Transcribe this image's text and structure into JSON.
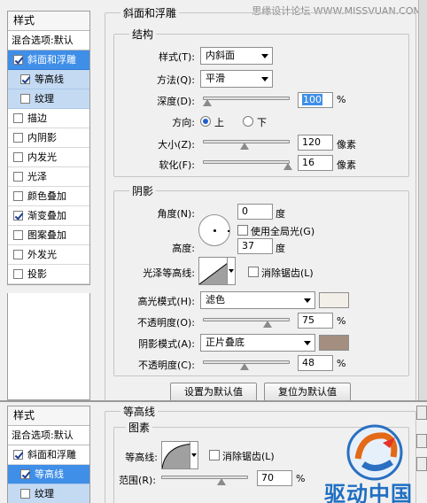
{
  "watermark": "思缘设计论坛 WWW.MISSVUAN.COM",
  "sidebar": {
    "header": "样式",
    "blend_options": "混合选项:默认",
    "items": [
      {
        "label": "斜面和浮雕",
        "checked": true,
        "selected": true,
        "sub": false
      },
      {
        "label": "等高线",
        "checked": true,
        "selected": false,
        "sub": true
      },
      {
        "label": "纹理",
        "checked": false,
        "selected": false,
        "sub": true
      },
      {
        "label": "描边",
        "checked": false,
        "selected": false,
        "sub": false
      },
      {
        "label": "内阴影",
        "checked": false,
        "selected": false,
        "sub": false
      },
      {
        "label": "内发光",
        "checked": false,
        "selected": false,
        "sub": false
      },
      {
        "label": "光泽",
        "checked": false,
        "selected": false,
        "sub": false
      },
      {
        "label": "颜色叠加",
        "checked": false,
        "selected": false,
        "sub": false
      },
      {
        "label": "渐变叠加",
        "checked": true,
        "selected": false,
        "sub": false
      },
      {
        "label": "图案叠加",
        "checked": false,
        "selected": false,
        "sub": false
      },
      {
        "label": "外发光",
        "checked": false,
        "selected": false,
        "sub": false
      },
      {
        "label": "投影",
        "checked": false,
        "selected": false,
        "sub": false
      }
    ]
  },
  "bevel": {
    "title": "斜面和浮雕",
    "structure": {
      "title": "结构",
      "style_label": "样式(T):",
      "style_value": "内斜面",
      "method_label": "方法(Q):",
      "method_value": "平滑",
      "depth_label": "深度(D):",
      "depth_value": "100",
      "depth_unit": "%",
      "depth_slider": 0.03,
      "direction_label": "方向:",
      "dir_up": "上",
      "dir_down": "下",
      "size_label": "大小(Z):",
      "size_value": "120",
      "size_unit": "像素",
      "size_slider": 0.48,
      "soften_label": "软化(F):",
      "soften_value": "16",
      "soften_unit": "像素",
      "soften_slider": 1.0
    },
    "shading": {
      "title": "阴影",
      "angle_label": "角度(N):",
      "angle_value": "0",
      "angle_unit": "度",
      "global_light_label": "使用全局光(G)",
      "altitude_label": "高度:",
      "altitude_value": "37",
      "altitude_unit": "度",
      "gloss_label": "光泽等高线:",
      "antialias_label": "消除锯齿(L)",
      "highlight_label": "高光模式(H):",
      "highlight_value": "滤色",
      "highlight_color": "#f2efe9",
      "highlight_opacity_label": "不透明度(O):",
      "highlight_opacity_value": "75",
      "highlight_opacity_slider": 0.75,
      "shadow_label": "阴影模式(A):",
      "shadow_value": "正片叠底",
      "shadow_color": "#a38e80",
      "shadow_opacity_label": "不透明度(C):",
      "shadow_opacity_value": "48",
      "shadow_opacity_slider": 0.48,
      "percent": "%"
    },
    "buttons": {
      "make_default": "设置为默认值",
      "reset_default": "复位为默认值"
    }
  },
  "sidebar2": {
    "header": "样式",
    "blend_options": "混合选项:默认",
    "items": [
      {
        "label": "斜面和浮雕",
        "checked": true,
        "selected": false,
        "sub": false
      },
      {
        "label": "等高线",
        "checked": true,
        "selected": true,
        "sub": true
      },
      {
        "label": "纹理",
        "checked": false,
        "selected": false,
        "sub": true
      }
    ]
  },
  "contour_panel": {
    "title": "等高线",
    "elements_title": "图素",
    "contour_label": "等高线:",
    "antialias_label": "消除锯齿(L)",
    "range_label": "范围(R):",
    "range_value": "70",
    "range_unit": "%",
    "range_slider": 0.7
  },
  "logo": {
    "text": "驱动中国"
  }
}
